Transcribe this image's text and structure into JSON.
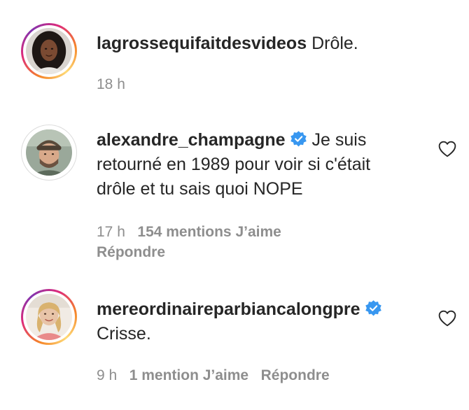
{
  "comments": [
    {
      "username": "lagrossequifaitdesvideos",
      "text": "Drôle.",
      "verified": false,
      "time": "18 h",
      "likes": "",
      "reply_label": ""
    },
    {
      "username": "alexandre_champagne",
      "text": "Je suis retourné en 1989 pour voir si c'était drôle et tu sais quoi NOPE",
      "verified": true,
      "time": "17 h",
      "likes": "154 mentions J’aime",
      "reply_label": "Répondre"
    },
    {
      "username": "mereordinaireparbiancalongpre",
      "text": "Crisse.",
      "verified": true,
      "time": "9 h",
      "likes": "1 mention J’aime",
      "reply_label": "Répondre"
    }
  ],
  "colors": {
    "text": "#262626",
    "muted": "#8e8e8e",
    "verified_blue": "#3897f0"
  },
  "icons": {
    "verified": "verified-badge-icon",
    "like": "heart-outline-icon"
  }
}
